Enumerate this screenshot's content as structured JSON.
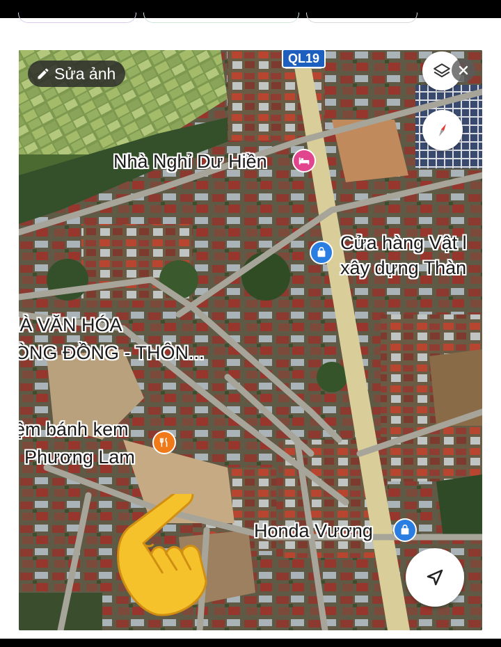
{
  "edit_button": {
    "label": "Sửa ảnh",
    "icon": "pencil-icon"
  },
  "road_shield": {
    "label": "QL19",
    "color": "#1d5fbf"
  },
  "places": [
    {
      "name": "Nhà Nghỉ Dư Hiền",
      "category": "lodging",
      "pin_color": "#e0458d",
      "icon": "bed-icon"
    },
    {
      "line1": "Cửa hàng Vật l",
      "line2": "xây dựng Thàn",
      "category": "shopping",
      "pin_color": "#2a7de1",
      "icon": "shopping-bag-icon"
    },
    {
      "line1": "IÀ VĂN HÓA",
      "line2": "ÒNG ĐỒNG - THÔN..."
    },
    {
      "line1": "ệm bánh kem",
      "line2": "Phương Lam",
      "category": "restaurant",
      "pin_color": "#f07a1a",
      "icon": "fork-knife-icon"
    },
    {
      "name": "Honda Vương",
      "category": "shopping",
      "pin_color": "#2a7de1",
      "icon": "shopping-bag-icon"
    }
  ],
  "overlay_sticker": "pointing-hand-emoji",
  "controls": [
    "layers-icon",
    "close-icon",
    "compass-icon",
    "my-location-icon"
  ]
}
